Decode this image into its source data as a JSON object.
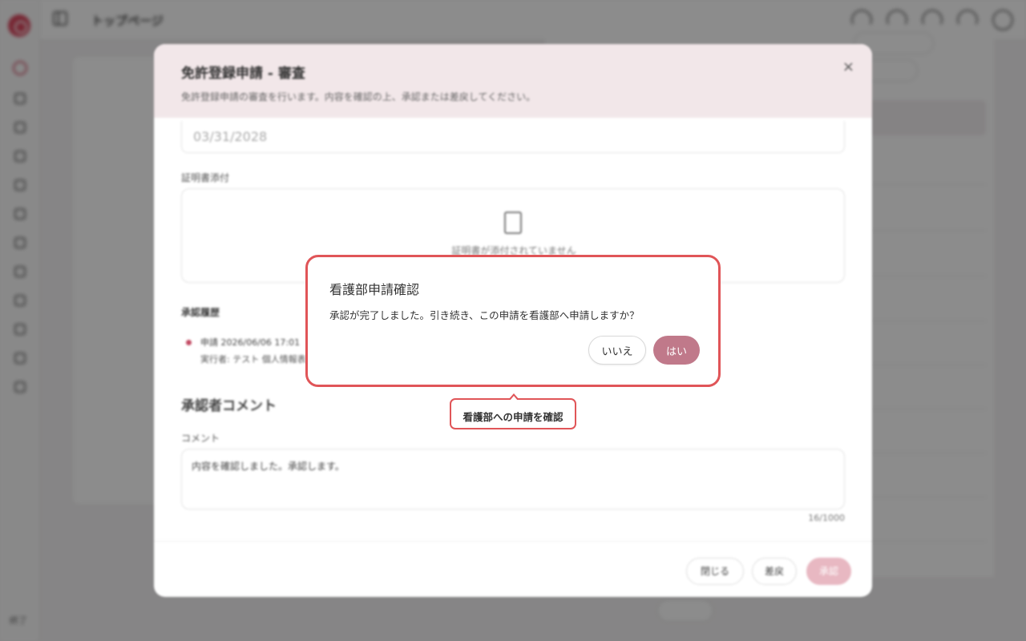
{
  "app": {
    "page_title": "トップページ",
    "sidebar_footer": "終了"
  },
  "review_modal": {
    "title": "免許登録申請 - 審査",
    "subtitle": "免許登録申請の審査を行います。内容を確認の上、承認または差戻してください。",
    "close_glyph": "×",
    "expiry_value": "03/31/2028",
    "attachment_label": "証明書添付",
    "attachment_empty": "証明書が添付されていません",
    "history_label": "承認履歴",
    "history_entry_line1": "申請  2026/06/06 17:01",
    "history_entry_line2": "実行者: テスト 個人情報表",
    "comment_heading": "承認者コメント",
    "comment_label": "コメント",
    "comment_value": "内容を確認しました。承認します。",
    "comment_count": "16/1000",
    "buttons": {
      "close": "閉じる",
      "reject": "差戻",
      "approve": "承認"
    }
  },
  "confirm_dialog": {
    "title": "看護部申請確認",
    "message": "承認が完了しました。引き続き、この申請を看護部へ申請しますか？",
    "no_label": "いいえ",
    "yes_label": "はい"
  },
  "tooltip": {
    "text": "看護部への申請を確認"
  },
  "colors": {
    "accent_red": "#e05558",
    "yes_button": "#c0798a",
    "modal_header": "#f2e7e9"
  }
}
